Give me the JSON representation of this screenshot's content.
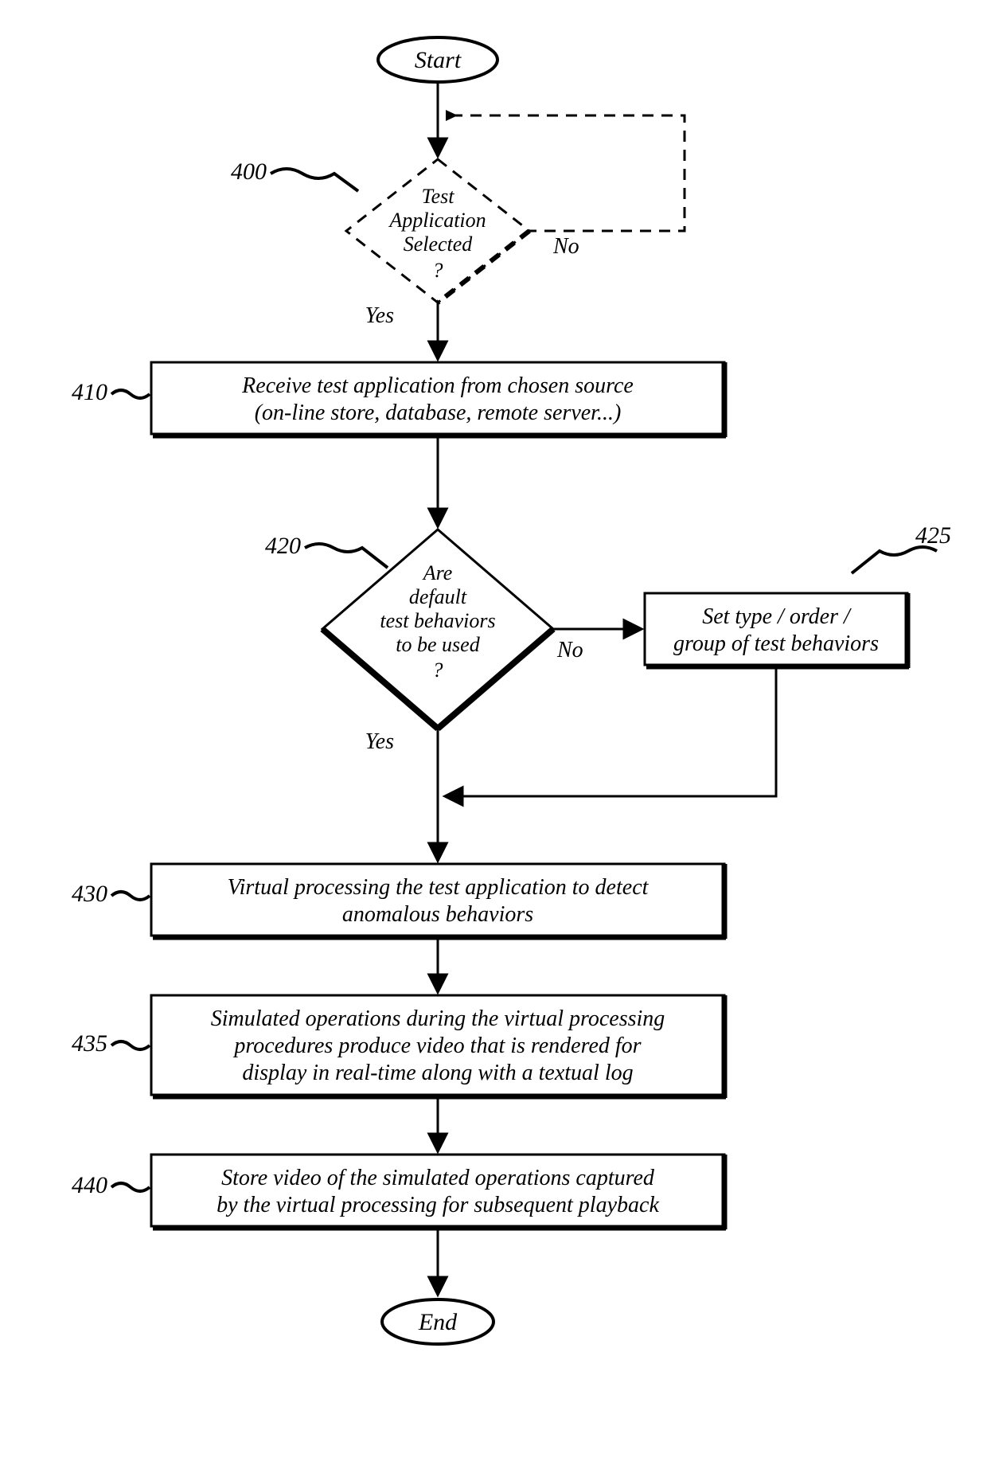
{
  "terminals": {
    "start": "Start",
    "end": "End"
  },
  "labels": {
    "n400": "400",
    "n410": "410",
    "n420": "420",
    "n425": "425",
    "n430": "430",
    "n435": "435",
    "n440": "440"
  },
  "decisions": {
    "d400": {
      "l1": "Test",
      "l2": "Application",
      "l3": "Selected",
      "l4": "?"
    },
    "d420": {
      "l1": "Are",
      "l2": "default",
      "l3": "test behaviors",
      "l4": "to be used",
      "l5": "?"
    }
  },
  "yn": {
    "yes": "Yes",
    "no": "No"
  },
  "boxes": {
    "b410": {
      "l1": "Receive test application from chosen source",
      "l2": "(on-line store, database, remote server...)"
    },
    "b425": {
      "l1": "Set type / order /",
      "l2": "group of test behaviors"
    },
    "b430": {
      "l1": "Virtual processing the test application to detect",
      "l2": "anomalous behaviors"
    },
    "b435": {
      "l1": "Simulated operations during the virtual processing",
      "l2": "procedures produce video that is rendered for",
      "l3": "display in real-time along with a textual log"
    },
    "b440": {
      "l1": "Store video of the simulated operations captured",
      "l2": "by the virtual processing for subsequent playback"
    }
  }
}
